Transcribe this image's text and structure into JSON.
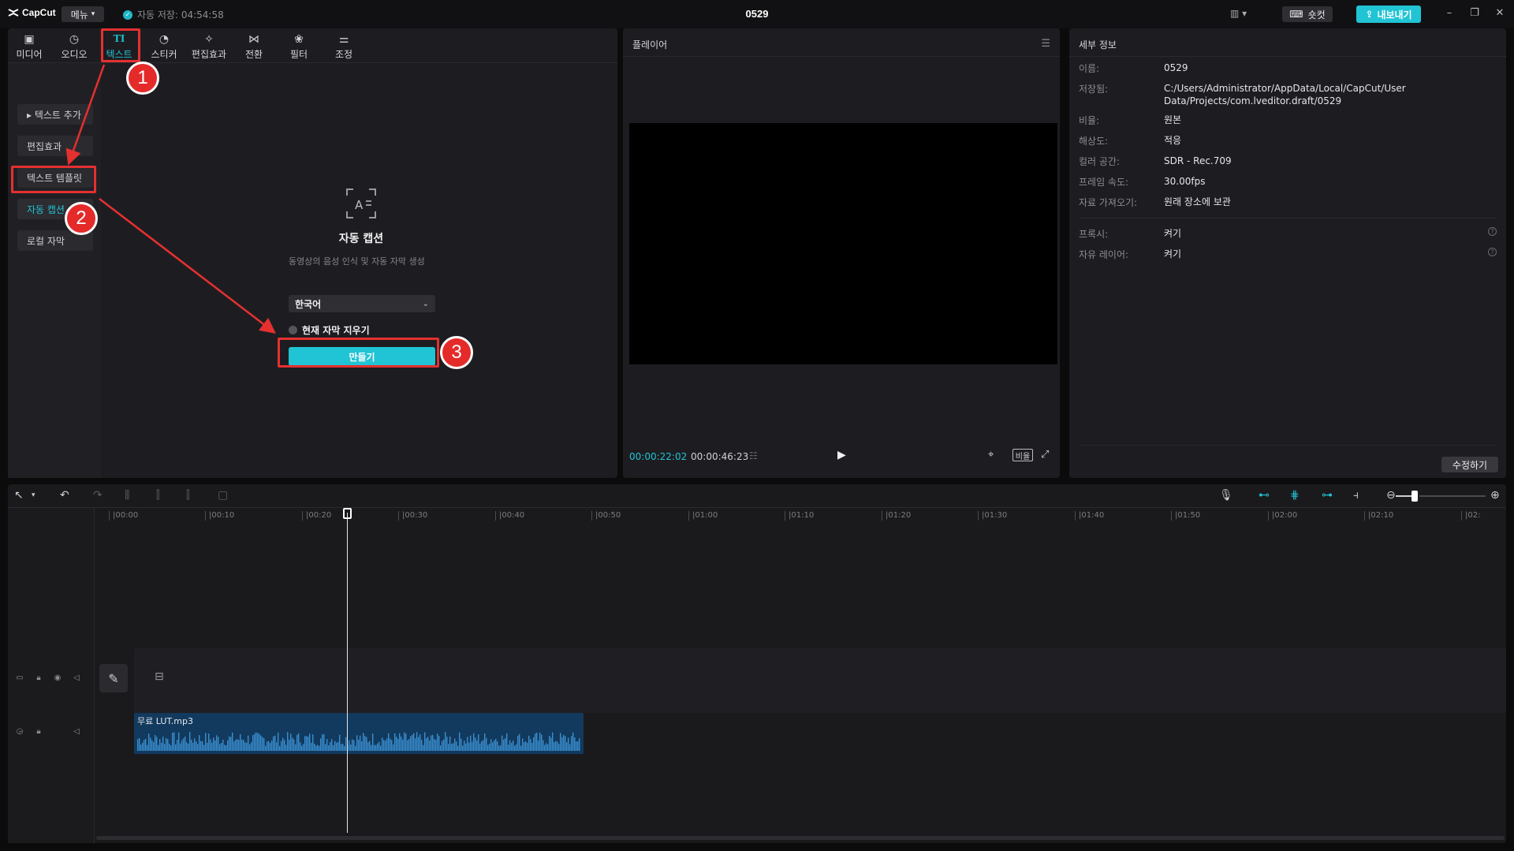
{
  "titlebar": {
    "logo": "CapCut",
    "menu": "메뉴",
    "autosave": "자동 저장: 04:54:58",
    "project_title": "0529",
    "shortcut": "숏컷",
    "export": "내보내기"
  },
  "toolbar": {
    "tabs": [
      {
        "label": "미디어",
        "icon": "media-icon"
      },
      {
        "label": "오디오",
        "icon": "audio-icon"
      },
      {
        "label": "텍스트",
        "icon": "text-icon",
        "glyph": "TI",
        "active": true
      },
      {
        "label": "스티커",
        "icon": "sticker-icon"
      },
      {
        "label": "편집효과",
        "icon": "effects-icon"
      },
      {
        "label": "전환",
        "icon": "transition-icon"
      },
      {
        "label": "필터",
        "icon": "filter-icon"
      },
      {
        "label": "조정",
        "icon": "adjust-icon"
      }
    ]
  },
  "subnav": {
    "items": [
      {
        "label": "▸ 텍스트 추가"
      },
      {
        "label": "편집효과"
      },
      {
        "label": "텍스트 템플릿"
      },
      {
        "label": "자동 캡션",
        "active": true
      },
      {
        "label": "로컬 자막"
      }
    ]
  },
  "auto_caption": {
    "title": "자동 캡션",
    "description": "동영상의 음성 인식 및 자동 자막 생성",
    "language": "한국어",
    "clear_label": "현재 자막 지우기",
    "create_button": "만들기"
  },
  "annotations": {
    "steps": [
      "1",
      "2",
      "3"
    ],
    "color": "#e53030"
  },
  "player": {
    "title": "플레이어",
    "current_time": "00:00:22:02",
    "total_time": "00:00:46:23",
    "ratio_label": "비율"
  },
  "details": {
    "title": "세부 정보",
    "rows": [
      {
        "label": "이름:",
        "value": "0529"
      },
      {
        "label": "저장됨:",
        "value": "C:/Users/Administrator/AppData/Local/CapCut/User Data/Projects/com.lveditor.draft/0529"
      },
      {
        "label": "비율:",
        "value": "원본"
      },
      {
        "label": "해상도:",
        "value": "적응"
      },
      {
        "label": "컬러 공간:",
        "value": "SDR - Rec.709"
      },
      {
        "label": "프레임 속도:",
        "value": "30.00fps"
      },
      {
        "label": "자료 가져오기:",
        "value": "원래 장소에 보관"
      }
    ],
    "rows2": [
      {
        "label": "프록시:",
        "value": "켜기"
      },
      {
        "label": "자유 레이어:",
        "value": "켜기"
      }
    ],
    "modify_button": "수정하기"
  },
  "timeline": {
    "ruler": [
      "|00:00",
      "|00:10",
      "|00:20",
      "|00:30",
      "|00:40",
      "|00:50",
      "|01:00",
      "|01:10",
      "|01:20",
      "|01:30",
      "|01:40",
      "|01:50",
      "|02:00",
      "|02:10",
      "|02:"
    ],
    "audio_clip_name": "무료 LUT.mp3"
  },
  "colors": {
    "accent": "#21c4d4",
    "panel": "#1d1d21",
    "audio_clip": "#123a5e"
  }
}
